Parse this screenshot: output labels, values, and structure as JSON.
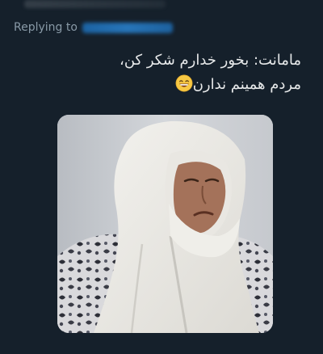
{
  "reply": {
    "prefix": "Replying to"
  },
  "tweet": {
    "lines": [
      "مامانت: بخور خدارم شکر کن،",
      "مردم همینم ندارن"
    ],
    "emoji": "grinning-face-with-smiling-eyes"
  },
  "media": {
    "type": "photo"
  }
}
